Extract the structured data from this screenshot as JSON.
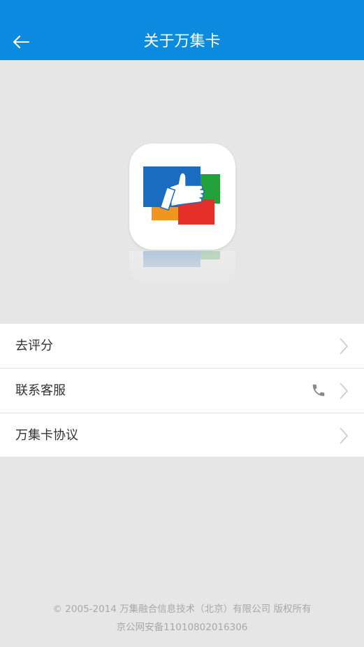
{
  "header": {
    "title": "关于万集卡",
    "back_icon": "arrow-left-icon"
  },
  "logo": {
    "icon": "thumbs-up-cards-icon",
    "colors": {
      "blue": "#1a6cc0",
      "green": "#23a23c",
      "orange": "#f0961e",
      "red": "#e43029"
    }
  },
  "menu": {
    "items": [
      {
        "label": "去评分",
        "trailing_icon": "chevron-right-icon"
      },
      {
        "label": "联系客服",
        "extra_icon": "phone-icon",
        "trailing_icon": "chevron-right-icon"
      },
      {
        "label": "万集卡协议",
        "trailing_icon": "chevron-right-icon"
      }
    ]
  },
  "footer": {
    "copyright": "© 2005-2014 万集融合信息技术（北京）有限公司 版权所有",
    "icp": "京公网安备11010802016306"
  },
  "colors": {
    "accent": "#0a8be0",
    "background": "#e6e6e6"
  }
}
